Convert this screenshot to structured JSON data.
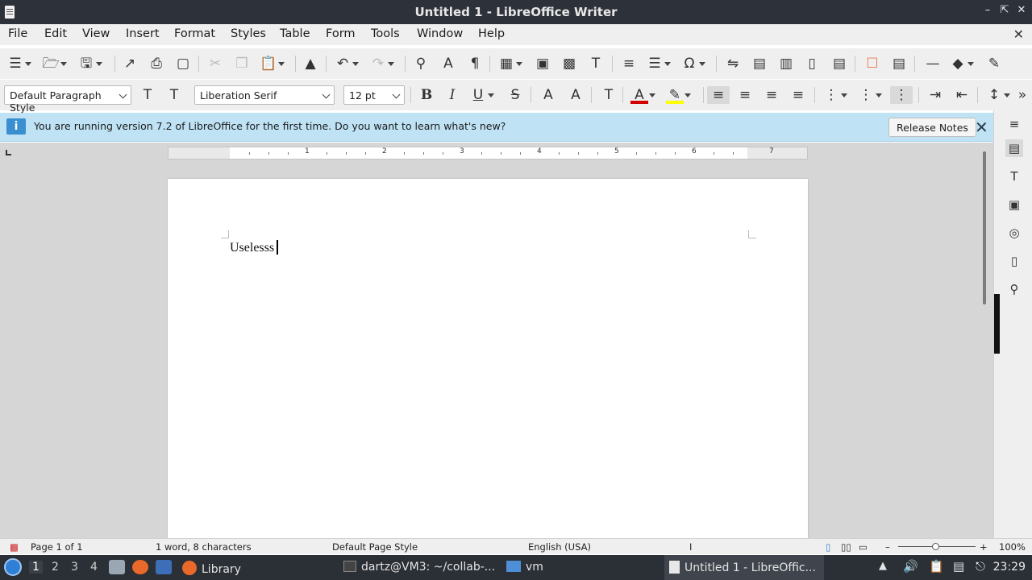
{
  "window": {
    "title": "Untitled 1 - LibreOffice Writer"
  },
  "menu": [
    "File",
    "Edit",
    "View",
    "Insert",
    "Format",
    "Styles",
    "Table",
    "Form",
    "Tools",
    "Window",
    "Help"
  ],
  "formatting": {
    "paragraph_style": "Default Paragraph Style",
    "font_name": "Liberation Serif",
    "font_size": "12 pt"
  },
  "infobar": {
    "message": "You are running version 7.2 of LibreOffice for the first time. Do you want to learn what's new?",
    "button_label": "Release Notes"
  },
  "ruler": {
    "numbers": [
      "1",
      "2",
      "3",
      "4",
      "5",
      "6",
      "7"
    ]
  },
  "document": {
    "text": "Uselesss"
  },
  "status": {
    "page": "Page 1 of 1",
    "words": "1 word, 8 characters",
    "page_style": "Default Page Style",
    "language": "English (USA)",
    "zoom": "100%"
  },
  "taskbar": {
    "workspaces": [
      "1",
      "2",
      "3",
      "4"
    ],
    "tasks": {
      "library": "Library",
      "terminal": "dartz@VM3: ~/collab-...",
      "files": "vm",
      "writer": "Untitled 1 - LibreOffic..."
    },
    "clock": "23:29"
  },
  "colors": {
    "titlebar": "#2d3139",
    "infobar": "#bfe3f5",
    "font_color_swatch": "#d00000",
    "highlight_swatch": "#ffff00",
    "taskbar": "#2b2f36"
  }
}
